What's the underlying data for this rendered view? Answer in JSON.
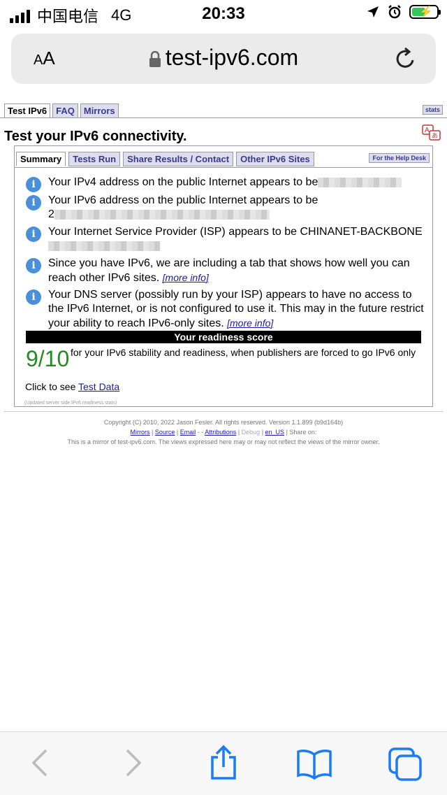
{
  "status_bar": {
    "carrier": "中国电信",
    "network": "4G",
    "time": "20:33"
  },
  "browser": {
    "aa_label_big": "A",
    "aa_label_small": "A",
    "url": "test-ipv6.com"
  },
  "site_tabs": [
    {
      "label": "Test IPv6"
    },
    {
      "label": "FAQ"
    },
    {
      "label": "Mirrors"
    }
  ],
  "stats_label": "stats",
  "headline": "Test your IPv6 connectivity.",
  "panel_tabs": [
    {
      "label": "Summary"
    },
    {
      "label": "Tests Run"
    },
    {
      "label": "Share Results / Contact"
    },
    {
      "label": "Other IPv6 Sites"
    }
  ],
  "help_desk_label": "For the Help Desk",
  "info_items": [
    {
      "text": "Your IPv4 address on the public Internet appears to be"
    },
    {
      "text": "Your IPv6 address on the public Internet appears to be",
      "text2": "2"
    },
    {
      "text": "Your Internet Service Provider (ISP) appears to be CHINANET-BACKBONE"
    },
    {
      "text": "Since you have IPv6, we are including a tab that shows how well you can reach other IPv6 sites.",
      "link": "[more info]"
    },
    {
      "text": "Your DNS server (possibly run by your ISP) appears to have no access to the IPv6 Internet, or is not configured to use it. This may in the future restrict your ability to reach IPv6-only sites.",
      "link": "[more info]"
    }
  ],
  "readiness": {
    "heading": "Your readiness score",
    "score": "9/10",
    "description": "for your IPv6 stability and readiness, when publishers are forced to go IPv6 only"
  },
  "test_data": {
    "prefix": "Click to see",
    "link": "Test Data"
  },
  "updated_note": "(Updated server side IPv6 readiness stats)",
  "footer": {
    "copyright": "Copyright (C) 2010, 2022 Jason Fesler. All rights reserved. Version 1.1.899 (b9d164b)",
    "links": {
      "mirrors": "Mirrors",
      "source": "Source",
      "email": "Email",
      "attributions": "Attributions",
      "debug": "Debug",
      "locale": "en_US",
      "share": "Share on:"
    },
    "mirror_note": "This is a mirror of test-ipv6.com. The views expressed here may or may not reflect the views of the mirror owner."
  },
  "colors": {
    "score_green": "#228b22",
    "info_blue": "#4a8fd9",
    "link_blue": "#1a1aa6",
    "toolbar_blue": "#1a7cf5"
  },
  "icons": {
    "info": "info-icon",
    "lock": "lock-icon",
    "reload": "reload-icon",
    "back": "back-icon",
    "forward": "forward-icon",
    "share": "share-icon",
    "bookmarks": "bookmarks-icon",
    "tabs": "tabs-icon"
  }
}
